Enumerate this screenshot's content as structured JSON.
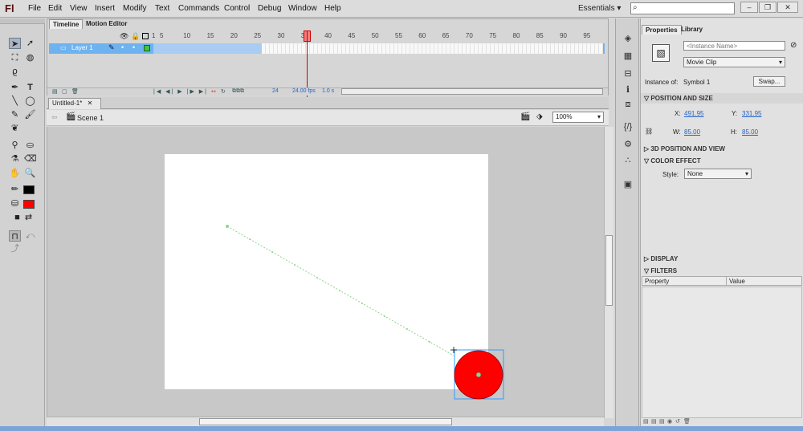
{
  "app": {
    "logo": "Fl"
  },
  "menu": [
    "File",
    "Edit",
    "View",
    "Insert",
    "Modify",
    "Text",
    "Commands",
    "Control",
    "Debug",
    "Window",
    "Help"
  ],
  "workspace": "Essentials",
  "timeline": {
    "tabs": [
      "Timeline",
      "Motion Editor"
    ],
    "layer_name": "Layer 1",
    "ruler": [
      "1",
      "5",
      "10",
      "15",
      "20",
      "25",
      "30",
      "35",
      "40",
      "45",
      "50",
      "55",
      "60",
      "65",
      "70",
      "75",
      "80",
      "85",
      "90",
      "95"
    ],
    "current_frame": "24",
    "fps": "24.00 fps",
    "elapsed": "1.0 s"
  },
  "document": {
    "tab": "Untitled-1*",
    "scene": "Scene 1",
    "zoom": "100%"
  },
  "properties": {
    "tabs": [
      "Properties",
      "Library"
    ],
    "instance_name_placeholder": "<Instance Name>",
    "symbol_type": "Movie Clip",
    "instance_of_label": "Instance of:",
    "instance_of": "Symbol 1",
    "swap": "Swap...",
    "sec_pos": "POSITION AND SIZE",
    "x_label": "X:",
    "x": "491.95",
    "y_label": "Y:",
    "y": "331.95",
    "w_label": "W:",
    "w": "85.00",
    "h_label": "H:",
    "h": "85.00",
    "sec_3d": "3D POSITION AND VIEW",
    "sec_color": "COLOR EFFECT",
    "style_label": "Style:",
    "style": "None",
    "sec_display": "DISPLAY",
    "sec_filters": "FILTERS",
    "filter_cols": [
      "Property",
      "Value"
    ]
  },
  "colors": {
    "stroke": "#000000",
    "fill": "#ff0000",
    "accent": "#6eb3f0",
    "playhead": "#d40000"
  }
}
